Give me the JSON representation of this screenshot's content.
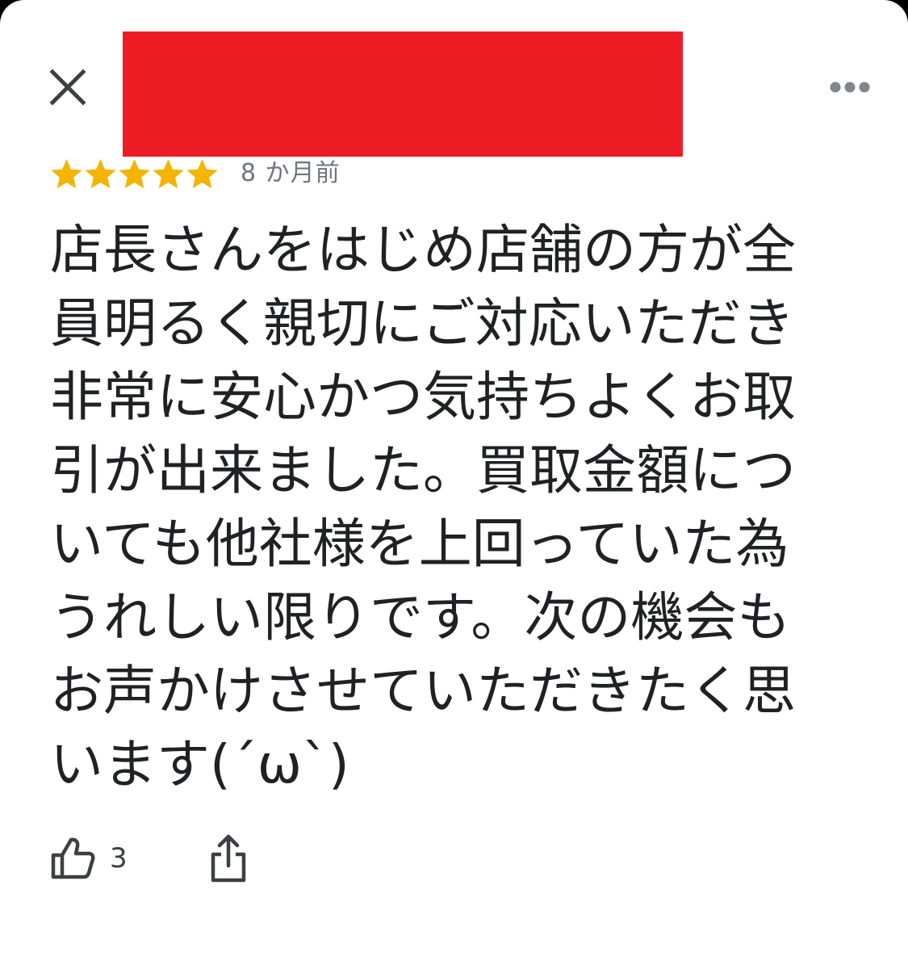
{
  "colors": {
    "star": "#f4b400",
    "text": "#202124",
    "muted": "#70757a",
    "redaction": "#ed1c24",
    "icon": "#3c4043"
  },
  "header": {
    "close_icon": "close-icon",
    "more_icon": "more-horizontal-icon"
  },
  "review": {
    "rating": 5,
    "max_rating": 5,
    "time_ago": "8 か月前",
    "text_lines": [
      "店長さんをはじめ店舗の方が全",
      "員明るく親切にご対応いただき",
      "非常に安心かつ気持ちよくお取",
      "引が出来ました。買取金額につ",
      "いても他社様を上回っていた為",
      "うれしい限りです。次の機会も",
      "お声かけさせていただきたく思",
      "います(´ω`)"
    ]
  },
  "actions": {
    "like_icon": "thumbs-up-icon",
    "like_count": "3",
    "share_icon": "share-icon"
  }
}
